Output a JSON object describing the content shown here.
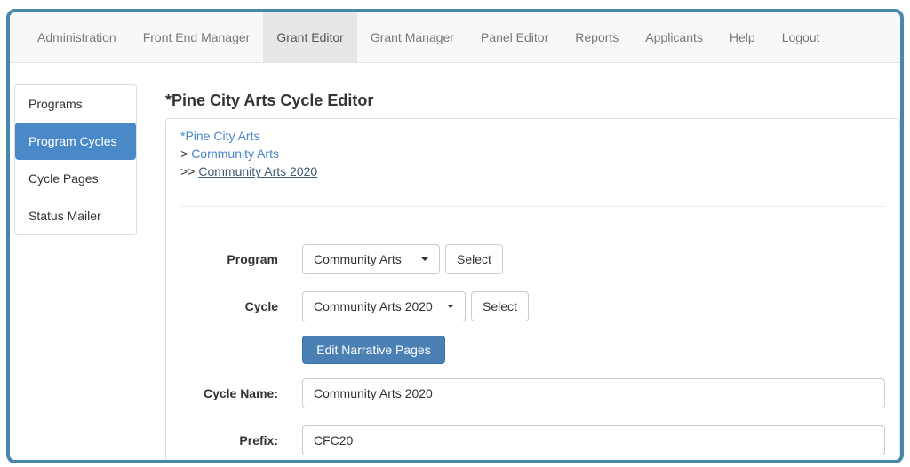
{
  "window": {
    "border_color": "#4a85ab"
  },
  "navbar": {
    "items": [
      {
        "label": "Administration"
      },
      {
        "label": "Front End Manager"
      },
      {
        "label": "Grant Editor"
      },
      {
        "label": "Grant Manager"
      },
      {
        "label": "Panel Editor"
      },
      {
        "label": "Reports"
      },
      {
        "label": "Applicants"
      },
      {
        "label": "Help"
      },
      {
        "label": "Logout"
      }
    ],
    "active_index": 2
  },
  "sidebar": {
    "items": [
      {
        "label": "Programs"
      },
      {
        "label": "Program Cycles"
      },
      {
        "label": "Cycle Pages"
      },
      {
        "label": "Status Mailer"
      }
    ],
    "active_index": 1
  },
  "main": {
    "title": "*Pine City Arts Cycle Editor",
    "breadcrumbs": [
      {
        "prefix": "",
        "label": "*Pine City Arts"
      },
      {
        "prefix": ">",
        "label": "Community Arts"
      },
      {
        "prefix": ">>",
        "label": "Community Arts 2020"
      }
    ],
    "form": {
      "program_label": "Program",
      "program_value": "Community Arts",
      "program_select_label": "Select",
      "cycle_label": "Cycle",
      "cycle_value": "Community Arts 2020",
      "cycle_select_label": "Select",
      "edit_narrative_label": "Edit Narrative Pages",
      "cycle_name_label": "Cycle Name:",
      "cycle_name_value": "Community Arts 2020",
      "prefix_label": "Prefix:",
      "prefix_value": "CFC20"
    }
  },
  "colors": {
    "sidebar_active_bg": "#4a89c8",
    "primary_button_bg": "#4a80b4",
    "link_blue": "#4a86c8",
    "current_crumb": "#3d5a76",
    "nav_bg": "#f8f8f8",
    "nav_active_bg": "#e7e7e7"
  }
}
